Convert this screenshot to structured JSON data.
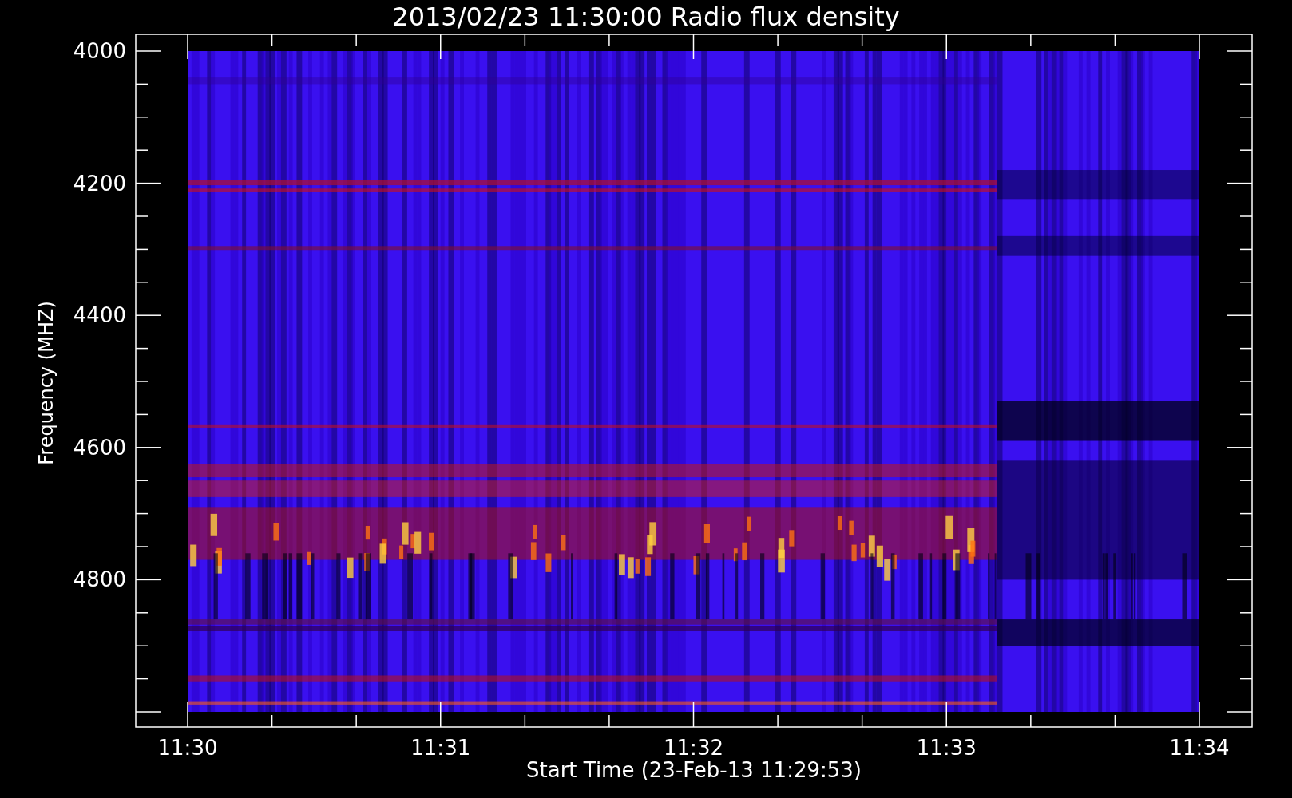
{
  "title": "2013/02/23 11:30:00 Radio flux density",
  "plot": {
    "ylabel": "Frequency (MHZ)",
    "xlabel": "Start Time (23-Feb-13 11:29:53)",
    "yticks": [
      "4000",
      "4200",
      "4400",
      "4600",
      "4800"
    ],
    "xticks": [
      "11:30",
      "11:31",
      "11:32",
      "11:33",
      "11:34"
    ]
  }
}
